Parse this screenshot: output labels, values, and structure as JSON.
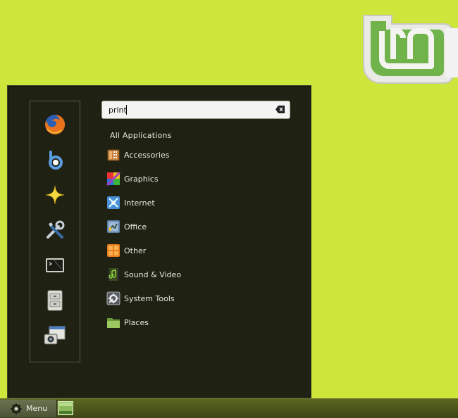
{
  "search": {
    "value": "print"
  },
  "favorites": [
    {
      "icon": "firefox-icon"
    },
    {
      "icon": "banshee-icon"
    },
    {
      "icon": "star-icon"
    },
    {
      "icon": "tools-icon"
    },
    {
      "icon": "terminal-icon"
    },
    {
      "icon": "drawers-icon"
    },
    {
      "icon": "screenshot-icon"
    }
  ],
  "categories": {
    "all_label": "All Applications",
    "items": [
      {
        "label": "Accessories",
        "icon": "accessories-icon"
      },
      {
        "label": "Graphics",
        "icon": "graphics-icon"
      },
      {
        "label": "Internet",
        "icon": "internet-icon"
      },
      {
        "label": "Office",
        "icon": "office-icon"
      },
      {
        "label": "Other",
        "icon": "other-icon"
      },
      {
        "label": "Sound & Video",
        "icon": "sound-video-icon"
      },
      {
        "label": "System Tools",
        "icon": "system-tools-icon"
      },
      {
        "label": "Places",
        "icon": "places-folder-icon"
      }
    ]
  },
  "panel": {
    "menu_label": "Menu"
  },
  "colors": {
    "desktop": "#cde63c",
    "menu_bg": "#1f2112",
    "text": "#e8e8e0"
  }
}
